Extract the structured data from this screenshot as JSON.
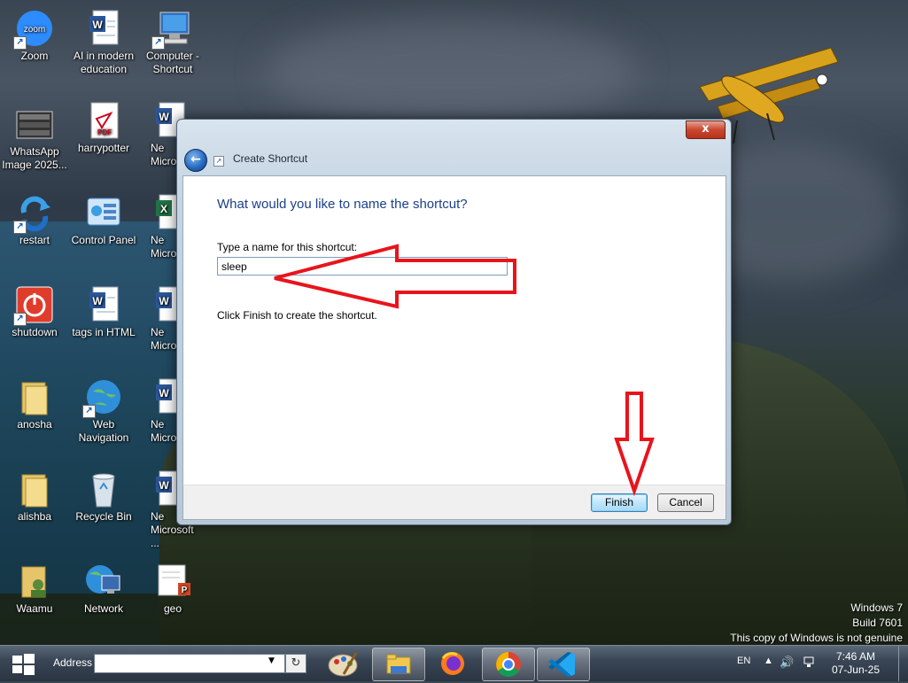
{
  "desktop": {
    "icons": [
      {
        "label": "Zoom",
        "icon": "zoom-icon"
      },
      {
        "label": "AI in modern education",
        "icon": "word-document-icon"
      },
      {
        "label": "Computer - Shortcut",
        "icon": "computer-icon"
      },
      {
        "label": "WhatsApp Image 2025...",
        "icon": "image-icon"
      },
      {
        "label": "harrypotter",
        "icon": "pdf-icon"
      },
      {
        "label": "Ne Micro",
        "icon": "word-document-icon"
      },
      {
        "label": "restart",
        "icon": "restart-icon"
      },
      {
        "label": "Control Panel",
        "icon": "control-panel-icon"
      },
      {
        "label": "Ne Micro",
        "icon": "excel-icon"
      },
      {
        "label": "shutdown",
        "icon": "power-icon"
      },
      {
        "label": "tags in HTML",
        "icon": "word-document-icon"
      },
      {
        "label": "Ne Micros",
        "icon": "word-document-icon"
      },
      {
        "label": "anosha",
        "icon": "folder-icon"
      },
      {
        "label": "Web Navigation",
        "icon": "globe-icon"
      },
      {
        "label": "Ne Micros",
        "icon": "word-document-icon"
      },
      {
        "label": "alishba",
        "icon": "folder-icon"
      },
      {
        "label": "Recycle Bin",
        "icon": "recycle-bin-icon"
      },
      {
        "label": "Ne Microsoft ...",
        "icon": "word-document-icon"
      },
      {
        "label": "Waamu",
        "icon": "folder-user-icon"
      },
      {
        "label": "Network",
        "icon": "network-icon"
      },
      {
        "label": "geo",
        "icon": "powerpoint-icon"
      }
    ]
  },
  "dialog": {
    "title": "Create Shortcut",
    "close_label": "x",
    "heading": "What would you like to name the shortcut?",
    "field_label": "Type a name for this shortcut:",
    "field_value": "sleep",
    "hint": "Click Finish to create the shortcut.",
    "finish_label": "Finish",
    "cancel_label": "Cancel"
  },
  "annotations": {
    "color": "#e8141c"
  },
  "watermark": {
    "line1": "Windows 7",
    "line2": "Build 7601",
    "line3": "This copy of Windows is not genuine"
  },
  "taskbar": {
    "address_label": "Address",
    "address_value": "",
    "pinned": [
      "paint-icon",
      "file-explorer-icon",
      "firefox-icon",
      "chrome-icon",
      "vscode-icon"
    ],
    "language": "EN",
    "time": "7:46 AM",
    "date": "07-Jun-25"
  }
}
